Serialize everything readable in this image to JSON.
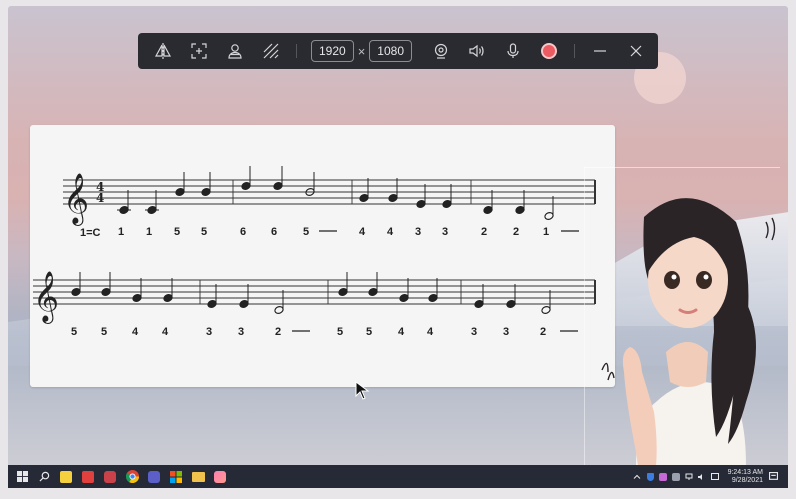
{
  "recorder": {
    "width_value": "1920",
    "times_symbol": "×",
    "height_value": "1080",
    "record_color": "#ec5b61"
  },
  "sheet": {
    "key_label": "1=C",
    "line1_numbers": [
      "1",
      "1",
      "5",
      "5",
      "6",
      "6",
      "5",
      "4",
      "4",
      "3",
      "3",
      "2",
      "2",
      "1"
    ],
    "line2_numbers": [
      "5",
      "5",
      "4",
      "4",
      "3",
      "3",
      "2",
      "5",
      "5",
      "4",
      "4",
      "3",
      "3",
      "2"
    ]
  },
  "taskbar": {
    "time": "9:24:13 AM",
    "date": "9/28/2021",
    "icons": [
      "windows-start-icon",
      "search-icon",
      "sticky-notes-icon",
      "app-red-icon",
      "media-icon",
      "chrome-icon",
      "teams-icon",
      "store-icon",
      "file-explorer-icon",
      "recorder-app-icon"
    ]
  }
}
